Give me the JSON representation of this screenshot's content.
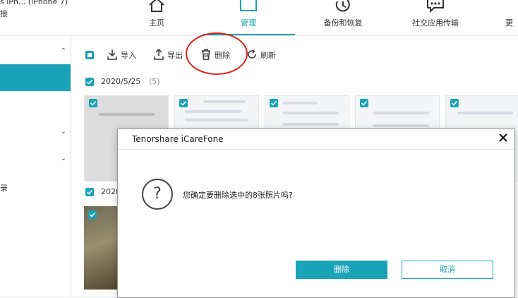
{
  "device": {
    "name": "s iPh... (iPhone 7)",
    "status": "接"
  },
  "nav": [
    {
      "label": "主页",
      "icon": "home-icon"
    },
    {
      "label": "管理",
      "icon": "folder-icon",
      "active": true
    },
    {
      "label": "备份和恢复",
      "icon": "backup-restore-icon"
    },
    {
      "label": "社交应用传输",
      "icon": "chat-transfer-icon"
    },
    {
      "label": "更",
      "icon": "more-icon"
    }
  ],
  "sidebar": {
    "items": [
      {
        "label": "",
        "chevron": "up"
      },
      {
        "label": "",
        "active": true
      },
      {
        "label": ""
      },
      {
        "label": "",
        "chevron": "down"
      },
      {
        "label": "",
        "chevron": "down"
      },
      {
        "label": "录"
      }
    ]
  },
  "toolbar": {
    "import_label": "导入",
    "export_label": "导出",
    "delete_label": "删除",
    "refresh_label": "刷新"
  },
  "groups": [
    {
      "date": "2020/5/25",
      "count": "(5)"
    },
    {
      "date": "2020"
    }
  ],
  "dialog": {
    "title": "Tenorshare iCareFone",
    "question_mark": "?",
    "message": "您确定要删除选中的8张照片吗?",
    "confirm_label": "删除",
    "cancel_label": "取消"
  },
  "colors": {
    "accent": "#1aa3b8",
    "annotation": "#e0201a"
  }
}
